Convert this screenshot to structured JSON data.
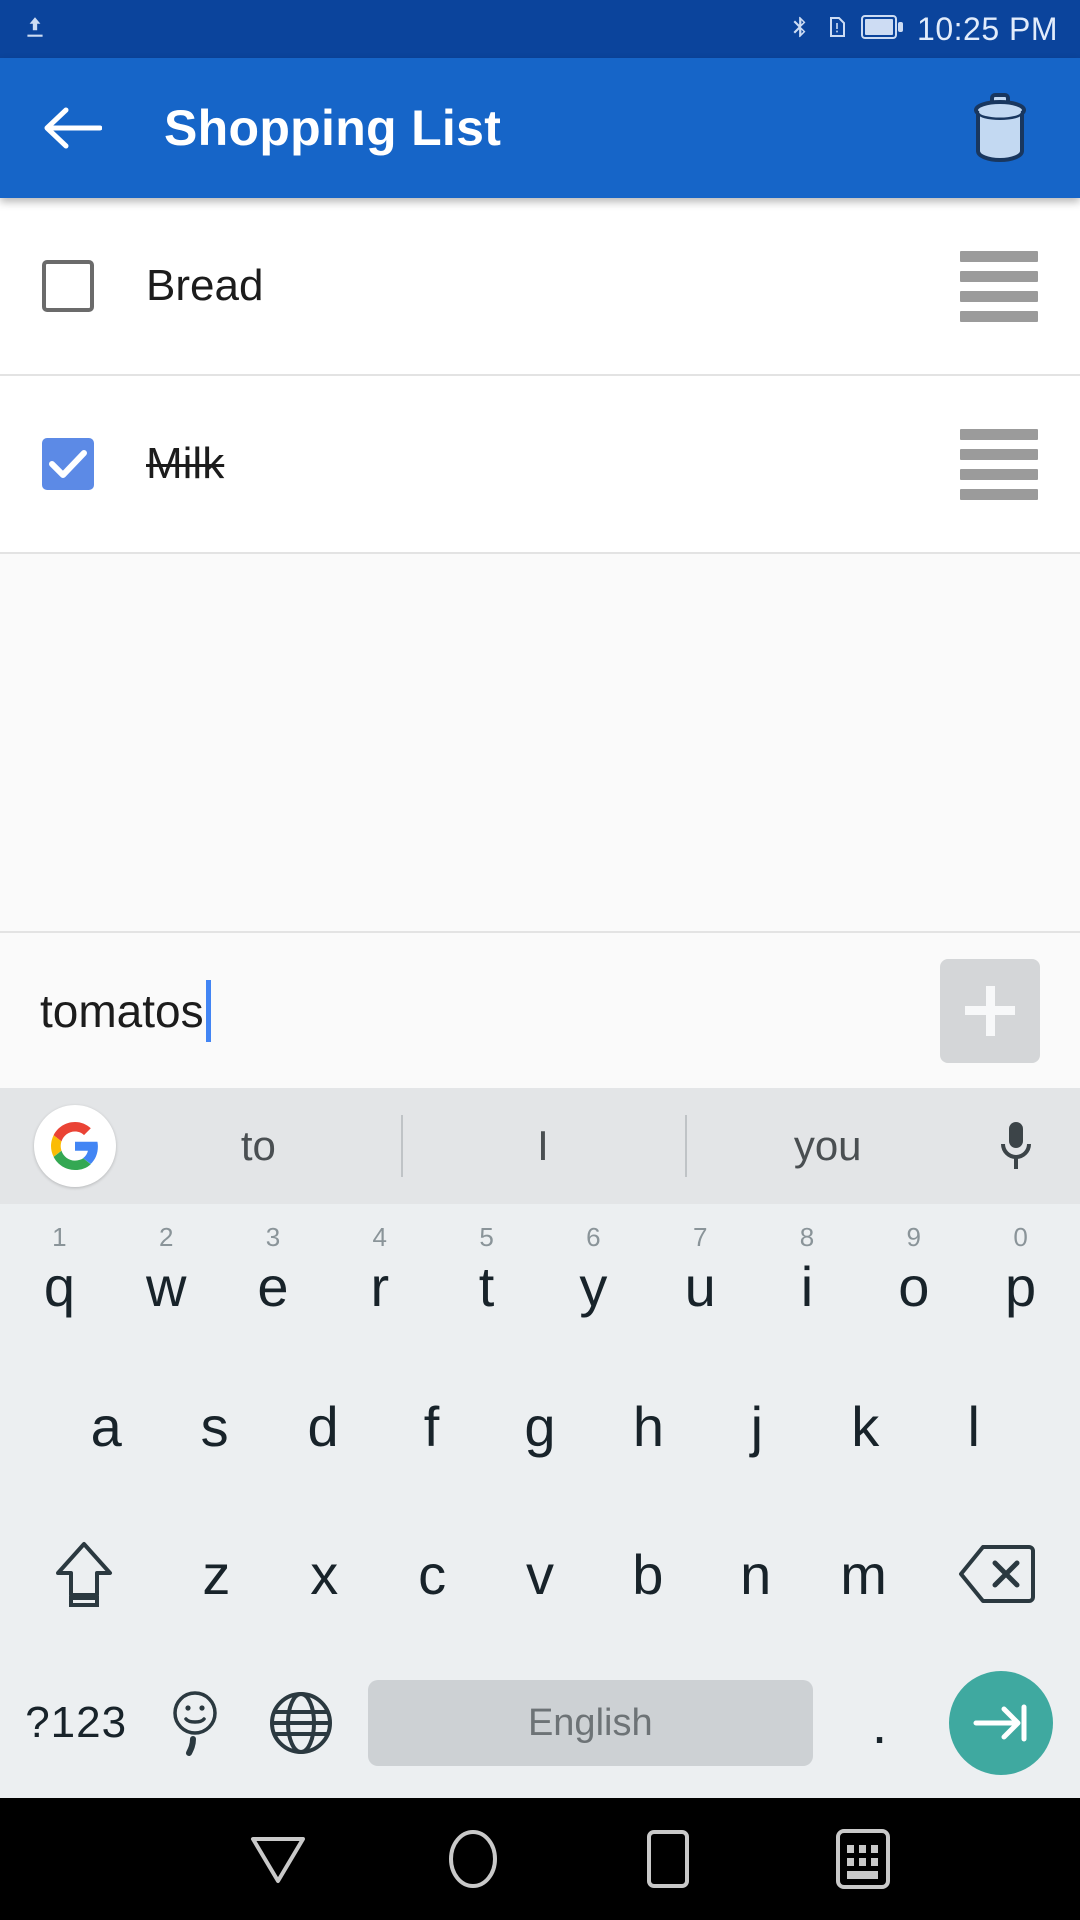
{
  "statusbar": {
    "time": "10:25 PM",
    "icons": {
      "upload": "upload-icon",
      "bluetooth": "bluetooth-icon",
      "sim_alert": "sim-card-alert-icon",
      "battery": "battery-icon"
    }
  },
  "appbar": {
    "title": "Shopping List",
    "back_label": "back-arrow",
    "delete_label": "delete-list"
  },
  "list": {
    "items": [
      {
        "label": "Bread",
        "checked": false
      },
      {
        "label": "Milk",
        "checked": true
      }
    ]
  },
  "new_item": {
    "value": "tomatos",
    "placeholder": "",
    "add_label": "+"
  },
  "keyboard": {
    "suggestions": [
      "to",
      "I",
      "you"
    ],
    "row1": [
      {
        "key": "q",
        "num": "1"
      },
      {
        "key": "w",
        "num": "2"
      },
      {
        "key": "e",
        "num": "3"
      },
      {
        "key": "r",
        "num": "4"
      },
      {
        "key": "t",
        "num": "5"
      },
      {
        "key": "y",
        "num": "6"
      },
      {
        "key": "u",
        "num": "7"
      },
      {
        "key": "i",
        "num": "8"
      },
      {
        "key": "o",
        "num": "9"
      },
      {
        "key": "p",
        "num": "0"
      }
    ],
    "row2": [
      "a",
      "s",
      "d",
      "f",
      "g",
      "h",
      "j",
      "k",
      "l"
    ],
    "row3": [
      "z",
      "x",
      "c",
      "v",
      "b",
      "n",
      "m"
    ],
    "symbols_key": "?123",
    "comma_key": ",",
    "space_label": "English",
    "period_key": ".",
    "shift_label": "shift-key",
    "backspace_label": "backspace-key",
    "globe_label": "language-switch-key",
    "emoji_label": "emoji-key",
    "enter_label": "enter-key",
    "mic_label": "voice-input"
  },
  "navbar": {
    "back": "back-nav",
    "home": "home-nav",
    "recents": "recents-nav",
    "hide_keyboard": "hide-keyboard-nav"
  },
  "colors": {
    "statusbar": "#0b449c",
    "appbar": "#1665c8",
    "checkbox_checked": "#5c8ae6",
    "caret": "#4285f4",
    "enter_key": "#3fa9a0",
    "keyboard_bg": "#eceff1"
  }
}
